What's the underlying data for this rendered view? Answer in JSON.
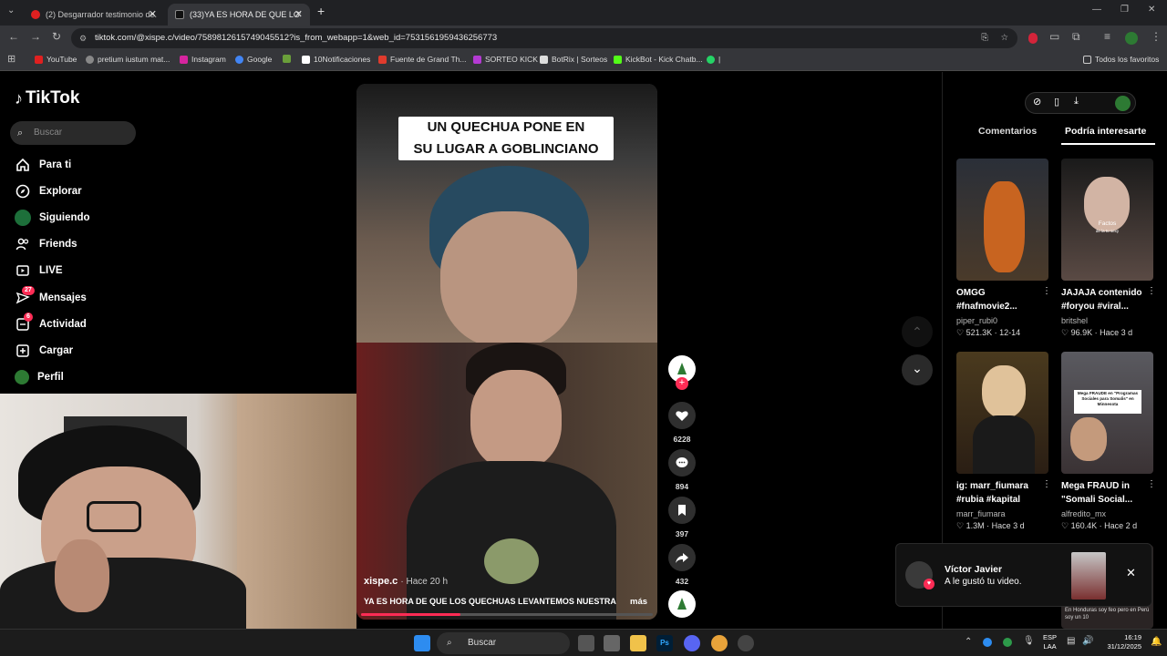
{
  "browser": {
    "tabs": [
      {
        "label": "(2) Desgarrador testimonio de..."
      },
      {
        "label": "(33)YA ES HORA DE QUE LOS Q..."
      }
    ],
    "url": "tiktok.com/@xispe.c/video/7589812615749045512?is_from_webapp=1&web_id=7531561959436256773",
    "bookmarks": [
      {
        "label": "YouTube",
        "color": "#e02020"
      },
      {
        "label": "pretium iustum mat...",
        "color": "#888888"
      },
      {
        "label": "Instagram",
        "color": "#d6249f"
      },
      {
        "label": "Google",
        "color": "#4285f4"
      },
      {
        "label": "",
        "color": "#6a9f3a"
      },
      {
        "label": "10Notificaciones",
        "color": "#ffffff"
      },
      {
        "label": "Fuente de Grand Th...",
        "color": "#e03b2d"
      },
      {
        "label": "SORTEO KICK",
        "color": "#b43ad3"
      },
      {
        "label": "BotRix | Sorteos",
        "color": "#dddddd"
      },
      {
        "label": "KickBot - Kick Chatb...",
        "color": "#53fc18"
      },
      {
        "label": "|",
        "color": "#25d366"
      }
    ],
    "all_favorites": "Todos los favoritos"
  },
  "sidebar": {
    "logo": "TikTok",
    "search_placeholder": "Buscar",
    "items": [
      {
        "label": "Para ti",
        "icon": "home-icon"
      },
      {
        "label": "Explorar",
        "icon": "compass-icon"
      },
      {
        "label": "Siguiendo",
        "icon": "following-icon"
      },
      {
        "label": "Friends",
        "icon": "friends-icon"
      },
      {
        "label": "LIVE",
        "icon": "live-icon"
      },
      {
        "label": "Mensajes",
        "icon": "messages-icon",
        "badge": "27"
      },
      {
        "label": "Actividad",
        "icon": "activity-icon",
        "badge": "6"
      },
      {
        "label": "Cargar",
        "icon": "upload-icon"
      },
      {
        "label": "Perfil",
        "icon": "profile-icon"
      }
    ]
  },
  "video": {
    "caption_line1": "UN QUECHUA PONE EN",
    "caption_line2": "SU LUGAR A GOBLINCIANO",
    "author": "xispe.c",
    "time": "· Hace 20 h",
    "description": "YA ES HORA DE QUE LOS QUECHUAS LEVANTEMOS NUESTRA",
    "more": "más",
    "progress": 0.34
  },
  "actions": {
    "likes": "6228",
    "comments": "894",
    "saves": "397",
    "shares": "432"
  },
  "right_panel": {
    "tab_comments": "Comentarios",
    "tab_suggested": "Podría interesarte",
    "cards": [
      {
        "title": "OMGG #fnafmovie2...",
        "user": "piper_rubi0",
        "views": "521.3K",
        "date": "12-14"
      },
      {
        "title": "JAJAJA contenido #foryou #viral...",
        "user": "britshel",
        "views": "96.9K",
        "date": "Hace 3 d"
      },
      {
        "title": "ig: marr_fiumara #rubia #kapital",
        "user": "marr_fiumara",
        "views": "1.3M",
        "date": "Hace 3 d"
      },
      {
        "title": "Mega FRAUD in \"Somali Social...",
        "user": "alfredito_mx",
        "views": "160.4K",
        "date": "Hace 2 d"
      }
    ],
    "thumb_text_2_a": "Factos",
    "thumb_text_2_b": "de la tu sexy",
    "thumb_text_4": "Mega FRAUDE en \"Programas Sociales para Somalis\" en Minnesota",
    "thumb_text_6": "En Honduras soy feo pero en Perú soy un 10"
  },
  "notification": {
    "name": "Víctor Javier",
    "message": "A le gustó tu video."
  },
  "taskbar": {
    "search": "Buscar",
    "lang": "ESP",
    "region": "LAA",
    "time": "16:19",
    "date": "31/12/2025"
  }
}
